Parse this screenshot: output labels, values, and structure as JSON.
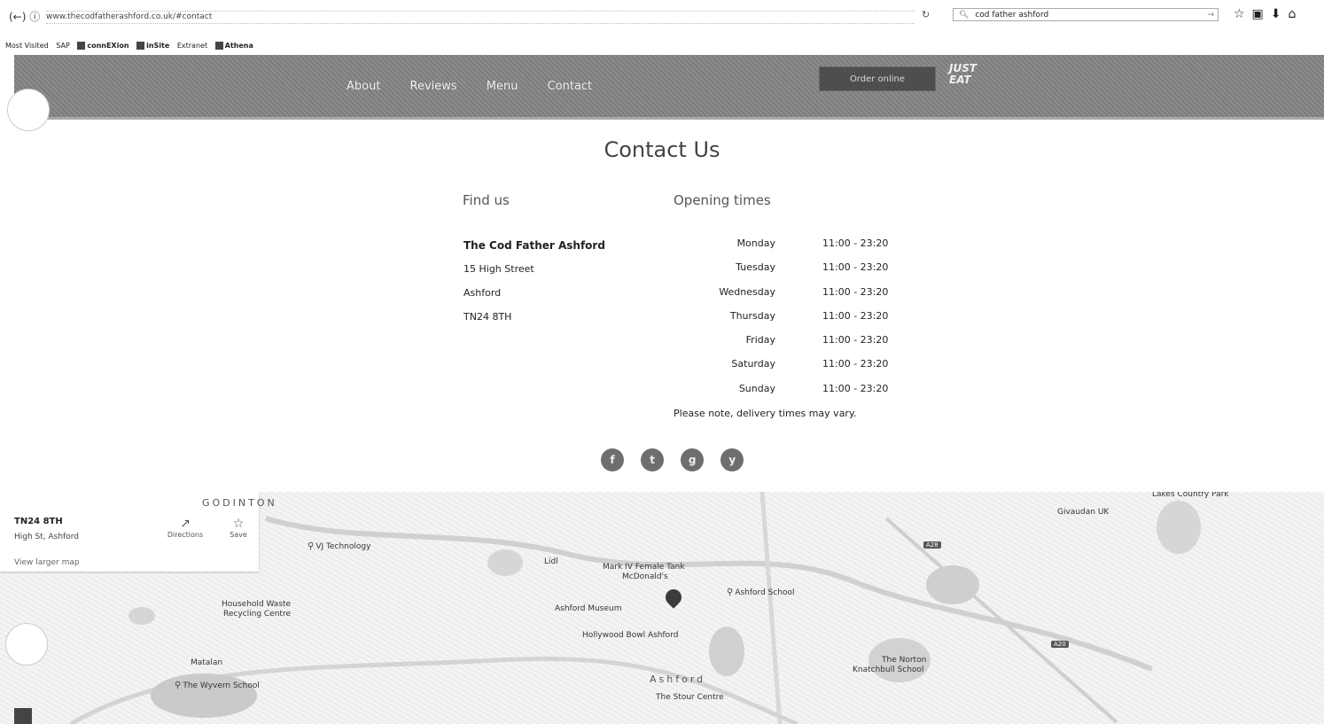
{
  "browser": {
    "url": "www.thecodfatherashford.co.uk/#contact",
    "search_value": "cod father ashford",
    "bookmarks": [
      "Most Visited",
      "SAP",
      "connEXion",
      "inSite",
      "Extranet",
      "Athena"
    ]
  },
  "header": {
    "nav": [
      "About",
      "Reviews",
      "Menu",
      "Contact"
    ],
    "order_button": "Order online",
    "partner": "JUST EAT"
  },
  "contact": {
    "title": "Contact Us",
    "find_us": {
      "heading": "Find us",
      "business": "The Cod Father Ashford",
      "street": "15 High Street",
      "town": "Ashford",
      "postcode": "TN24 8TH"
    },
    "opening": {
      "heading": "Opening times",
      "rows": [
        {
          "day": "Monday",
          "time": "11:00 - 23:20"
        },
        {
          "day": "Tuesday",
          "time": "11:00 - 23:20"
        },
        {
          "day": "Wednesday",
          "time": "11:00 - 23:20"
        },
        {
          "day": "Thursday",
          "time": "11:00 - 23:20"
        },
        {
          "day": "Friday",
          "time": "11:00 - 23:20"
        },
        {
          "day": "Saturday",
          "time": "11:00 - 23:20"
        },
        {
          "day": "Sunday",
          "time": "11:00 - 23:20"
        }
      ],
      "note": "Please note, delivery times may vary."
    },
    "social": [
      "f",
      "t",
      "g",
      "y"
    ]
  },
  "map": {
    "card": {
      "title": "TN24 8TH",
      "subtitle": "High St, Ashford",
      "link": "View larger map",
      "directions": "Directions",
      "save": "Save"
    },
    "labels": {
      "godinton": "GODINTON",
      "vj": "VJ Technology",
      "household": "Household Waste",
      "recycling": "Recycling Centre",
      "lidl": "Lidl",
      "markiv": "Mark IV Female Tank",
      "mcdonalds": "McDonald's",
      "museum": "Ashford Museum",
      "school": "Ashford School",
      "bowl": "Hollywood Bowl Ashford",
      "town": "Ashford",
      "stour": "The Stour Centre",
      "matalan": "Matalan",
      "wyvern": "The Wyvern School",
      "norton": "The Norton",
      "knatchbull": "Knatchbull School",
      "givaudan": "Givaudan UK",
      "lakes": "Lakes Country Park"
    }
  }
}
